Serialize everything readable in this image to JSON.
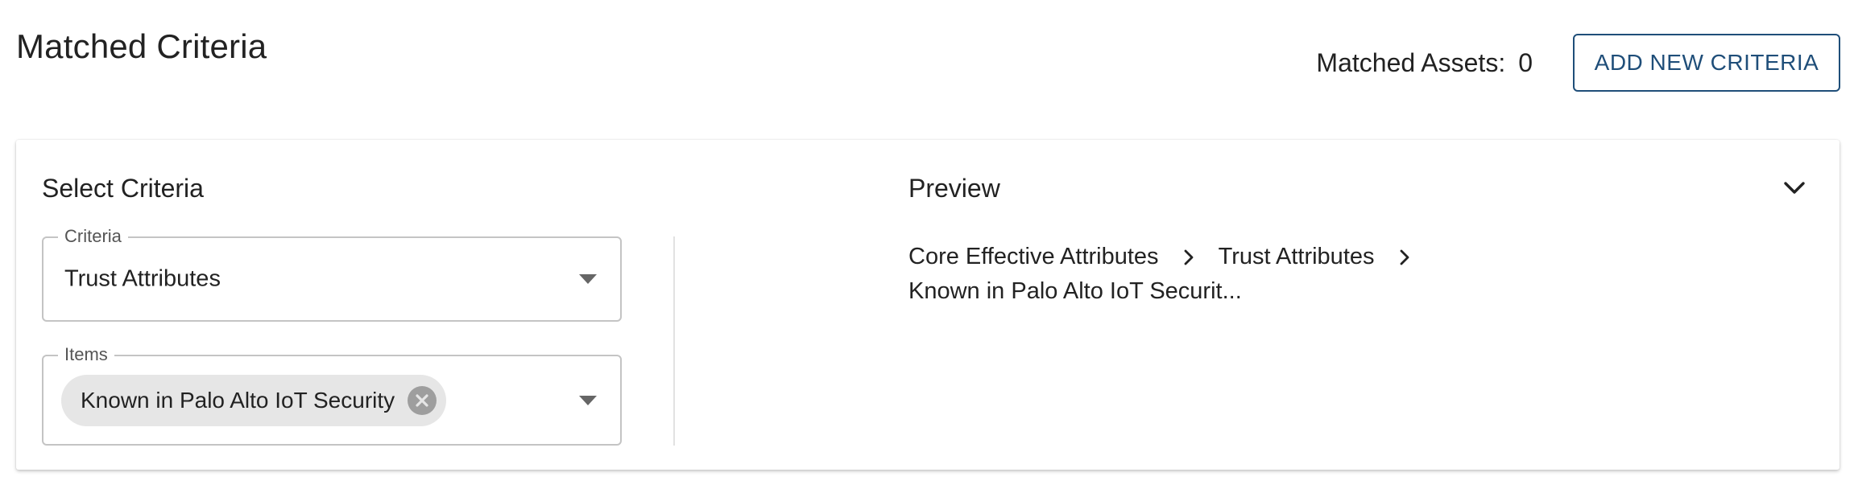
{
  "header": {
    "title": "Matched Criteria",
    "matched_assets_label": "Matched Assets:",
    "matched_assets_count": "0",
    "add_button_label": "ADD NEW CRITERIA"
  },
  "select_panel": {
    "title": "Select Criteria",
    "criteria": {
      "label": "Criteria",
      "value": "Trust Attributes"
    },
    "items": {
      "label": "Items",
      "chips": [
        "Known in Palo Alto IoT Security"
      ]
    }
  },
  "preview_panel": {
    "title": "Preview",
    "breadcrumb": [
      "Core Effective Attributes",
      "Trust Attributes",
      "Known in Palo Alto IoT Securit..."
    ]
  },
  "icons": {
    "collapse": "chevron-down-icon",
    "dropdown": "caret-down-icon",
    "chip_remove": "close-circle-icon",
    "breadcrumb_separator": "chevron-right-icon"
  },
  "colors": {
    "accent": "#1f4e79",
    "chip_bg": "#e6e6e6",
    "border": "#c4c4c4"
  }
}
